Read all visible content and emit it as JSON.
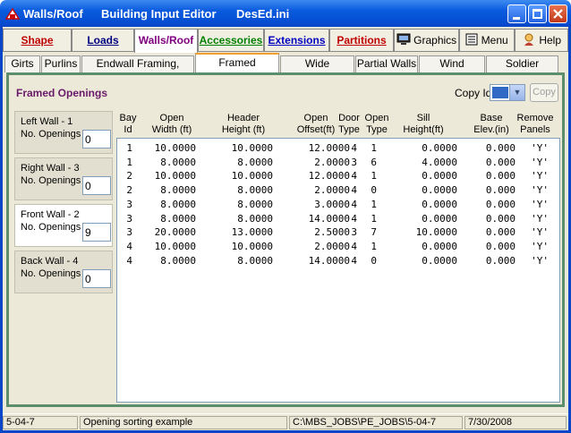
{
  "window": {
    "app_name": "Walls/Roof",
    "editor_title": "Building Input Editor",
    "file_name": "DesEd.ini"
  },
  "main_tabs": [
    {
      "label": "Shape",
      "color": "#c00000"
    },
    {
      "label": "Loads",
      "color": "#000080"
    },
    {
      "label": "Walls/Roof",
      "color": "#800080"
    },
    {
      "label": "Accessories",
      "color": "#008000"
    },
    {
      "label": "Extensions",
      "color": "#0000c0"
    },
    {
      "label": "Partitions",
      "color": "#c00000"
    },
    {
      "label": "Graphics",
      "color": "#000000"
    },
    {
      "label": "Menu",
      "color": "#000000"
    },
    {
      "label": "Help",
      "color": "#000000"
    }
  ],
  "sub_tabs": [
    "Girts",
    "Purlins",
    "Endwall Framing, Panels",
    "Framed Openings",
    "Wide Openings",
    "Partial Walls",
    "Wind Framing",
    "Soldier Column"
  ],
  "active_sub_tab": "Framed Openings",
  "panel": {
    "title": "Framed Openings",
    "copy_id_label": "Copy Id",
    "copy_button": "Copy"
  },
  "walls": [
    {
      "name": "Left Wall - 1",
      "label": "No. Openings",
      "value": "0"
    },
    {
      "name": "Right Wall - 3",
      "label": "No. Openings",
      "value": "0"
    },
    {
      "name": "Front Wall - 2",
      "label": "No. Openings",
      "value": "9"
    },
    {
      "name": "Back Wall - 4",
      "label": "No. Openings",
      "value": "0"
    }
  ],
  "columns": [
    {
      "l1": "Bay",
      "l2": "Id"
    },
    {
      "l1": "Open",
      "l2": "Width (ft)"
    },
    {
      "l1": "Header",
      "l2": "Height (ft)"
    },
    {
      "l1": "Open",
      "l2": "Offset(ft)"
    },
    {
      "l1": "Door",
      "l2": "Type"
    },
    {
      "l1": "Open",
      "l2": "Type"
    },
    {
      "l1": "Sill",
      "l2": "Height(ft)"
    },
    {
      "l1": "Base",
      "l2": "Elev.(in)"
    },
    {
      "l1": "Remove",
      "l2": "Panels"
    }
  ],
  "rows": [
    [
      "1",
      "10.0000",
      "10.0000",
      "12.0000",
      "4",
      "1",
      "0.0000",
      "0.000",
      "'Y'"
    ],
    [
      "1",
      "8.0000",
      "8.0000",
      "2.0000",
      "3",
      "6",
      "4.0000",
      "0.000",
      "'Y'"
    ],
    [
      "2",
      "10.0000",
      "10.0000",
      "12.0000",
      "4",
      "1",
      "0.0000",
      "0.000",
      "'Y'"
    ],
    [
      "2",
      "8.0000",
      "8.0000",
      "2.0000",
      "4",
      "0",
      "0.0000",
      "0.000",
      "'Y'"
    ],
    [
      "3",
      "8.0000",
      "8.0000",
      "3.0000",
      "4",
      "1",
      "0.0000",
      "0.000",
      "'Y'"
    ],
    [
      "3",
      "8.0000",
      "8.0000",
      "14.0000",
      "4",
      "1",
      "0.0000",
      "0.000",
      "'Y'"
    ],
    [
      "3",
      "20.0000",
      "13.0000",
      "2.5000",
      "3",
      "7",
      "10.0000",
      "0.000",
      "'Y'"
    ],
    [
      "4",
      "10.0000",
      "10.0000",
      "2.0000",
      "4",
      "1",
      "0.0000",
      "0.000",
      "'Y'"
    ],
    [
      "4",
      "8.0000",
      "8.0000",
      "14.0000",
      "4",
      "0",
      "0.0000",
      "0.000",
      "'Y'"
    ]
  ],
  "status": {
    "job": "5-04-7",
    "description": "Opening sorting example",
    "path": "C:\\MBS_JOBS\\PE_JOBS\\5-04-7",
    "date": "7/30/2008"
  }
}
